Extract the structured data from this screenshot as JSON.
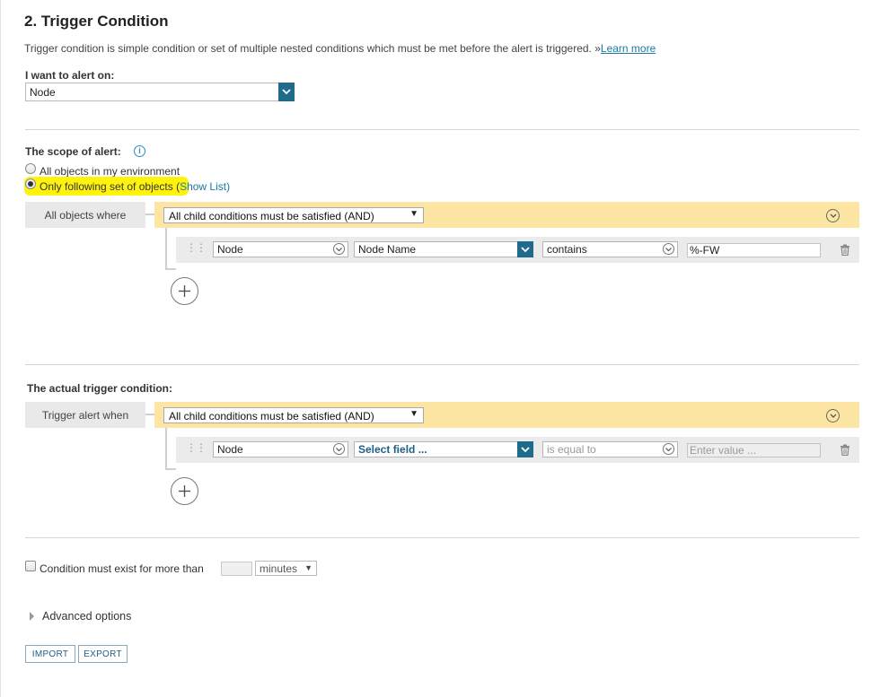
{
  "section": {
    "title": "2. Trigger Condition",
    "description": "Trigger condition is simple condition or set of multiple nested conditions which must be met before the alert is triggered. »",
    "learn_more": "Learn more"
  },
  "alert_on": {
    "label": "I want to alert on:",
    "value": "Node"
  },
  "scope": {
    "label": "The scope of alert:",
    "info_icon": "info-icon",
    "option_all": "All objects in my environment",
    "option_only": "Only following set of objects (",
    "show_list": "Show List",
    "close_paren": ")",
    "selected": "only",
    "group_label": "All objects where",
    "group_operator": "All child conditions must be satisfied (AND)",
    "condition": {
      "object": "Node",
      "field": "Node Name",
      "operator": "contains",
      "value": "%-FW"
    }
  },
  "trigger": {
    "label": "The actual trigger condition:",
    "group_label": "Trigger alert when",
    "group_operator": "All child conditions must be satisfied (AND)",
    "condition": {
      "object": "Node",
      "field": "Select field ...",
      "operator": "is equal to",
      "value_placeholder": "Enter value ..."
    }
  },
  "duration": {
    "label": "Condition must exist for more than",
    "value": "",
    "unit": "minutes"
  },
  "advanced": {
    "label": "Advanced options"
  },
  "buttons": {
    "import": "IMPORT",
    "export": "EXPORT"
  },
  "colors": {
    "accent": "#1f6b8c",
    "group_bar": "#fde6a3",
    "highlight": "#fff200",
    "link": "#1a7aa8"
  }
}
